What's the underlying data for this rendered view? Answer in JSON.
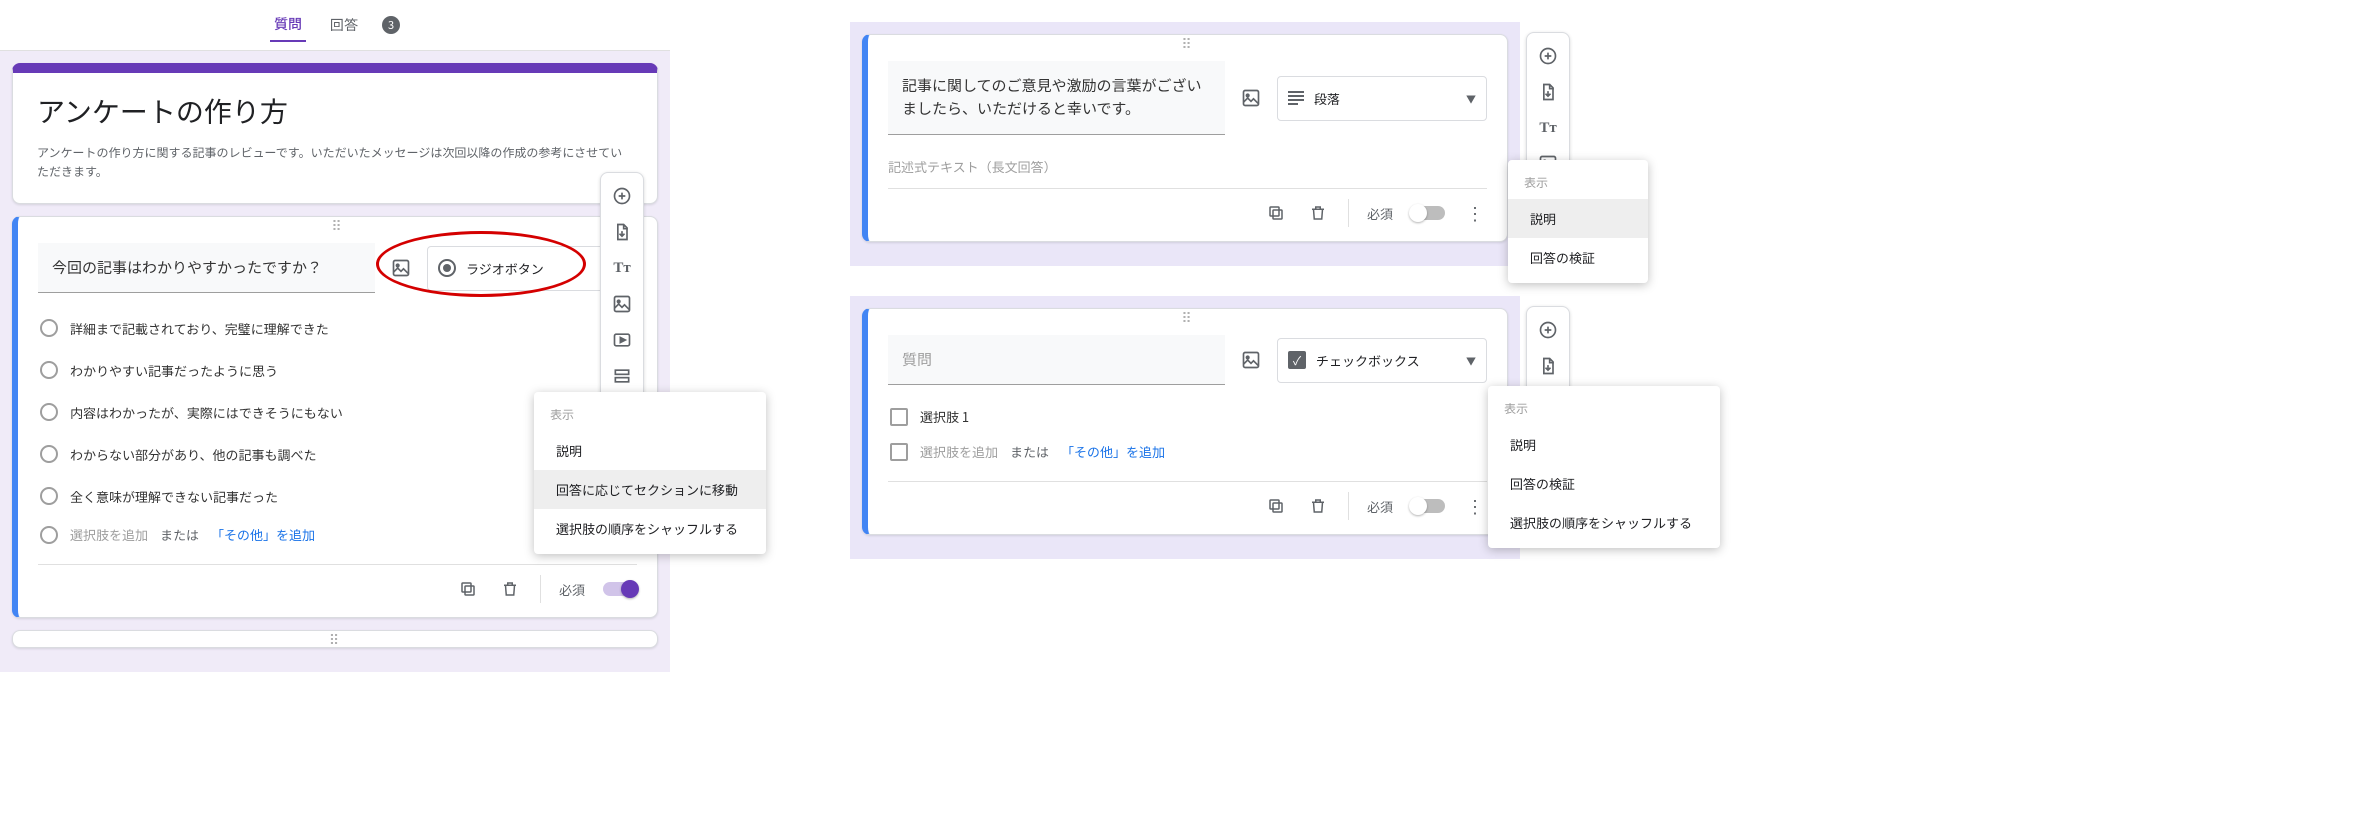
{
  "tabs": {
    "questions": "質問",
    "responses": "回答",
    "responses_count": "3"
  },
  "header": {
    "title": "アンケートの作り方",
    "desc": "アンケートの作り方に関する記事のレビューです。いただいたメッセージは次回以降の作成の参考にさせていただきます。"
  },
  "left_question": {
    "title": "今回の記事はわかりやすかったですか？",
    "type_label": "ラジオボタン",
    "options": [
      "詳細まで記載されており、完璧に理解できた",
      "わかりやすい記事だったように思う",
      "内容はわかったが、実際にはできそうにもない",
      "わからない部分があり、他の記事も調べた",
      "全く意味が理解できない記事だった"
    ],
    "add_option": "選択肢を追加",
    "or": "または",
    "add_other": "「その他」を追加",
    "required": "必須"
  },
  "left_menu": {
    "header": "表示",
    "desc": "説明",
    "go_section": "回答に応じてセクションに移動",
    "shuffle": "選択肢の順序をシャッフルする"
  },
  "right_a": {
    "question": "記事に関してのご意見や激励の言葉がございましたら、いただけると幸いです。",
    "type_label": "段落",
    "placeholder": "記述式テキスト（長文回答）",
    "required": "必須",
    "menu_header": "表示",
    "menu_desc": "説明",
    "menu_validate": "回答の検証"
  },
  "right_b": {
    "question_placeholder": "質問",
    "type_label": "チェックボックス",
    "option1": "選択肢 1",
    "add_option": "選択肢を追加",
    "or": "または",
    "add_other": "「その他」を追加",
    "required": "必須",
    "menu_header": "表示",
    "menu_desc": "説明",
    "menu_validate": "回答の検証",
    "menu_shuffle": "選択肢の順序をシャッフルする"
  },
  "chart_data": {
    "type": "table",
    "note": "no chart in image"
  }
}
